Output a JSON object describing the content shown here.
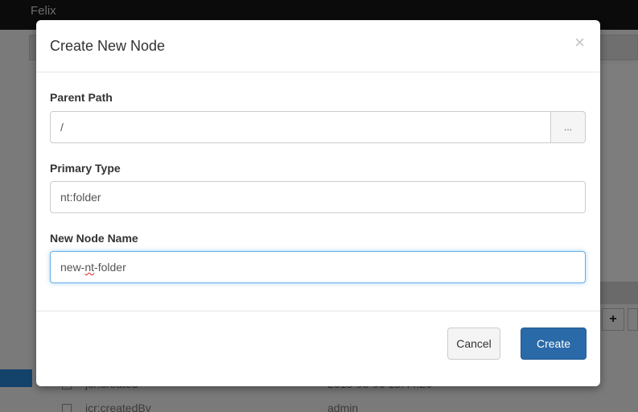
{
  "app": {
    "brand": "Felix"
  },
  "background": {
    "add_symbol": "+",
    "rows": [
      {
        "key": "jcr:created",
        "value": "2015-05-06 15:44:20"
      },
      {
        "key": "jcr:createdBy",
        "value": "admin"
      }
    ]
  },
  "dialog": {
    "title": "Create New Node",
    "close_symbol": "×",
    "parent_path": {
      "label": "Parent Path",
      "value": "/",
      "browse_label": "..."
    },
    "primary_type": {
      "label": "Primary Type",
      "value": "nt:folder"
    },
    "node_name": {
      "label": "New Node Name",
      "value_prefix": "new-",
      "value_misspelled": "nt",
      "value_suffix": "-folder"
    },
    "buttons": {
      "cancel": "Cancel",
      "create": "Create"
    }
  },
  "colors": {
    "primary": "#2b6aa8",
    "focus": "#66afe9",
    "overlay_dark": "#0b0b0b"
  }
}
